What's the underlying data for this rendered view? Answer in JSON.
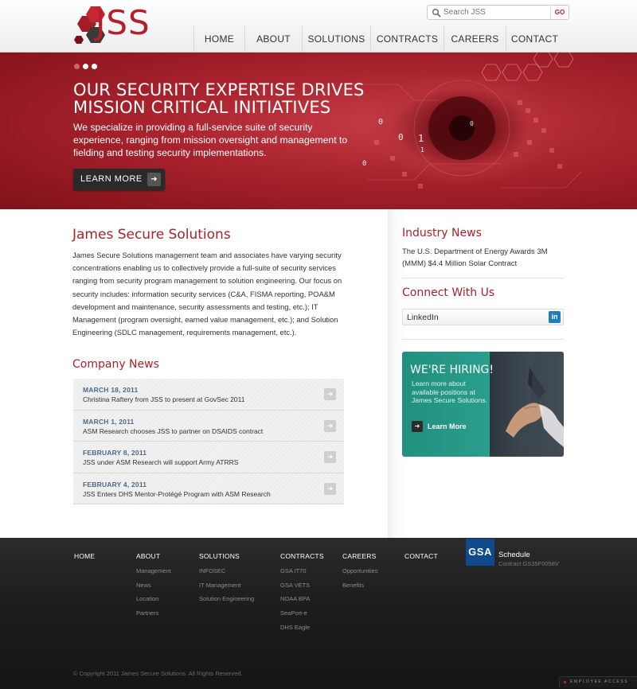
{
  "header": {
    "logo_text": "JSS",
    "search": {
      "placeholder": "Search JSS",
      "go_label": "GO"
    },
    "nav": [
      "HOME",
      "ABOUT",
      "SOLUTIONS",
      "CONTRACTS",
      "CAREERS",
      "CONTACT"
    ]
  },
  "hero": {
    "title": "OUR SECURITY EXPERTISE DRIVES MISSION CRITICAL INITIATIVES",
    "text": "We specialize in providing a full-service suite of security experience, ranging from mission oversight and management to fielding and testing security implementations.",
    "button_label": "LEARN MORE",
    "slide_count": 3,
    "active_slide": 2
  },
  "intro": {
    "title": "James Secure Solutions",
    "text": "James Secure Solutions management team and associates have varying security concentrations enabling us to collectively provide a full-suite of security services ranging from security program management to solution engineering. Our focus on security includes: information security services (C&A, FISMA reporting, POA&M development and maintenance, security assessments and testing, etc.); IT Management (program oversight, earned value management, etc.); and Solution Engineering (SDLC management, requirements management, etc.)."
  },
  "company_news": {
    "title": "Company News",
    "items": [
      {
        "date": "MARCH 18, 2011",
        "headline": "Christina Raftery from JSS to present at GovSec 2011"
      },
      {
        "date": "MARCH 1, 2011",
        "headline": "ASM Research chooses JSS to partner on DSAIDS contract"
      },
      {
        "date": "FEBRUARY 8, 2011",
        "headline": "JSS under ASM Research will support Army ATRRS"
      },
      {
        "date": "FEBRUARY 4, 2011",
        "headline": "JSS Enters DHS Mentor-Protégé Program with ASM Research"
      }
    ]
  },
  "sidebar": {
    "industry_title": "Industry News",
    "industry_text": "The U.S. Department of Energy Awards 3M (MMM) $4.4 Million Solar Contract",
    "connect_title": "Connect With Us",
    "linkedin_label": "LinkedIn",
    "linkedin_icon_text": "in",
    "hiring": {
      "title": "WE'RE HIRING!",
      "text": "Learn more about available positions at James Secure Solutions.",
      "button_label": "Learn More"
    }
  },
  "footer": {
    "columns": [
      {
        "heading": "HOME",
        "links": []
      },
      {
        "heading": "ABOUT",
        "links": [
          "Management",
          "News",
          "Location",
          "Partners"
        ]
      },
      {
        "heading": "SOLUTIONS",
        "links": [
          "INFOSEC",
          "IT Management",
          "Solution Engineering"
        ]
      },
      {
        "heading": "CONTRACTS",
        "links": [
          "GSA IT70",
          "GSA VETS",
          "NOAA BPA",
          "SeaPort-e",
          "DHS Eagle"
        ]
      },
      {
        "heading": "CAREERS",
        "links": [
          "Opportunities",
          "Benefits"
        ]
      },
      {
        "heading": "CONTACT",
        "links": []
      }
    ],
    "gsa": {
      "logo_text": "GSA",
      "title": "Schedule",
      "contract": "Contract GS35F0058V"
    },
    "copyright": "© Copyright 2011 James Secure Solutions. All Rights Reserved.",
    "employee_access": "EMPLOYEE ACCESS"
  },
  "colors": {
    "brand_red": "#b31f2a",
    "teal": "#21907f",
    "footer_bg": "#1e1e1e",
    "date_blue": "#4c6a87"
  }
}
